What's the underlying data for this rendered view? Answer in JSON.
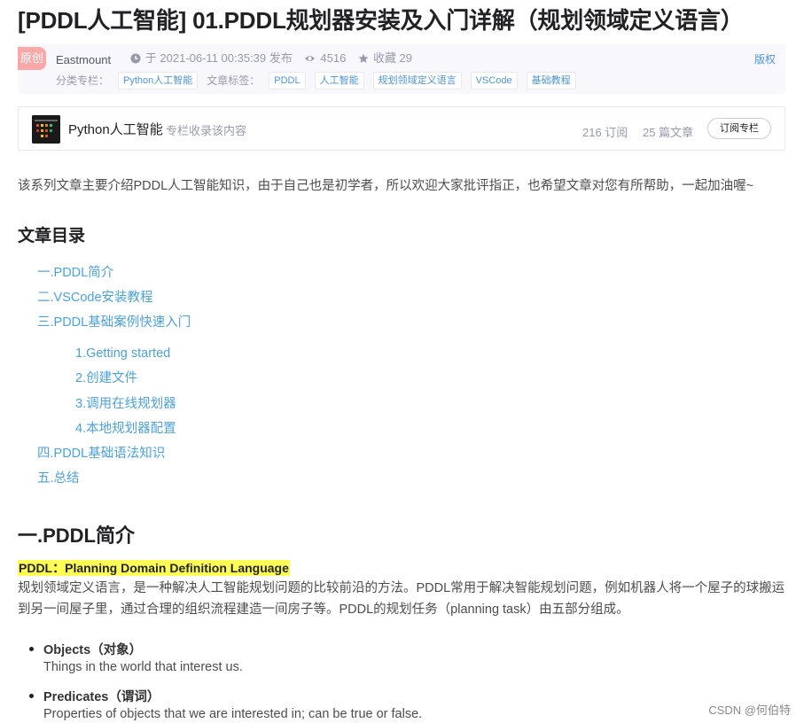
{
  "article": {
    "title": "[PDDL人工智能] 01.PDDL规划器安装及入门详解（规划领域定义语言）"
  },
  "meta": {
    "badge": "原创",
    "author": "Eastmount",
    "published": "于 2021-06-11 00:35:39 发布",
    "views": "4516",
    "favorites": "收藏 29",
    "copyright": "版权",
    "category_label": "分类专栏：",
    "category": "Python人工智能",
    "tags_label": "文章标签：",
    "tags": [
      "PDDL",
      "人工智能",
      "规划领域定义语言",
      "VSCode",
      "基础教程"
    ]
  },
  "column": {
    "name": "Python人工智能",
    "desc": "专栏收录该内容",
    "subscribers": "216 订阅",
    "articles": "25 篇文章",
    "subscribe_label": "订阅专栏"
  },
  "intro": "该系列文章主要介绍PDDL人工智能知识，由于自己也是初学者，所以欢迎大家批评指正，也希望文章对您有所帮助，一起加油喔~",
  "toc": {
    "heading": "文章目录",
    "items": [
      "一.PDDL简介",
      "二.VSCode安装教程",
      "三.PDDL基础案例快速入门",
      "1.Getting started",
      "2.创建文件",
      "3.调用在线规划器",
      "4.本地规划器配置",
      "四.PDDL基础语法知识",
      "五.总结"
    ]
  },
  "section1": {
    "heading": "一.PDDL简介",
    "highlight": "PDDL：Planning Domain Definition Language",
    "para_line1": "规划领域定义语言，是一种解决人工智能规划问题的比较前沿的方法。PDDL常用于解决智能规划问题，例如机器人将一个屋子的球搬运",
    "para_line2": "到另一间屋子里，通过合理的组织流程建造一间房子等。PDDL的规划任务（planning task）由五部分组成。",
    "items": [
      {
        "title": "Objects（对象）",
        "desc": "Things in the world that interest us."
      },
      {
        "title": "Predicates（谓词）",
        "desc": "Properties of objects that we are interested in; can be true or false."
      }
    ]
  },
  "watermark": "CSDN @何伯特"
}
